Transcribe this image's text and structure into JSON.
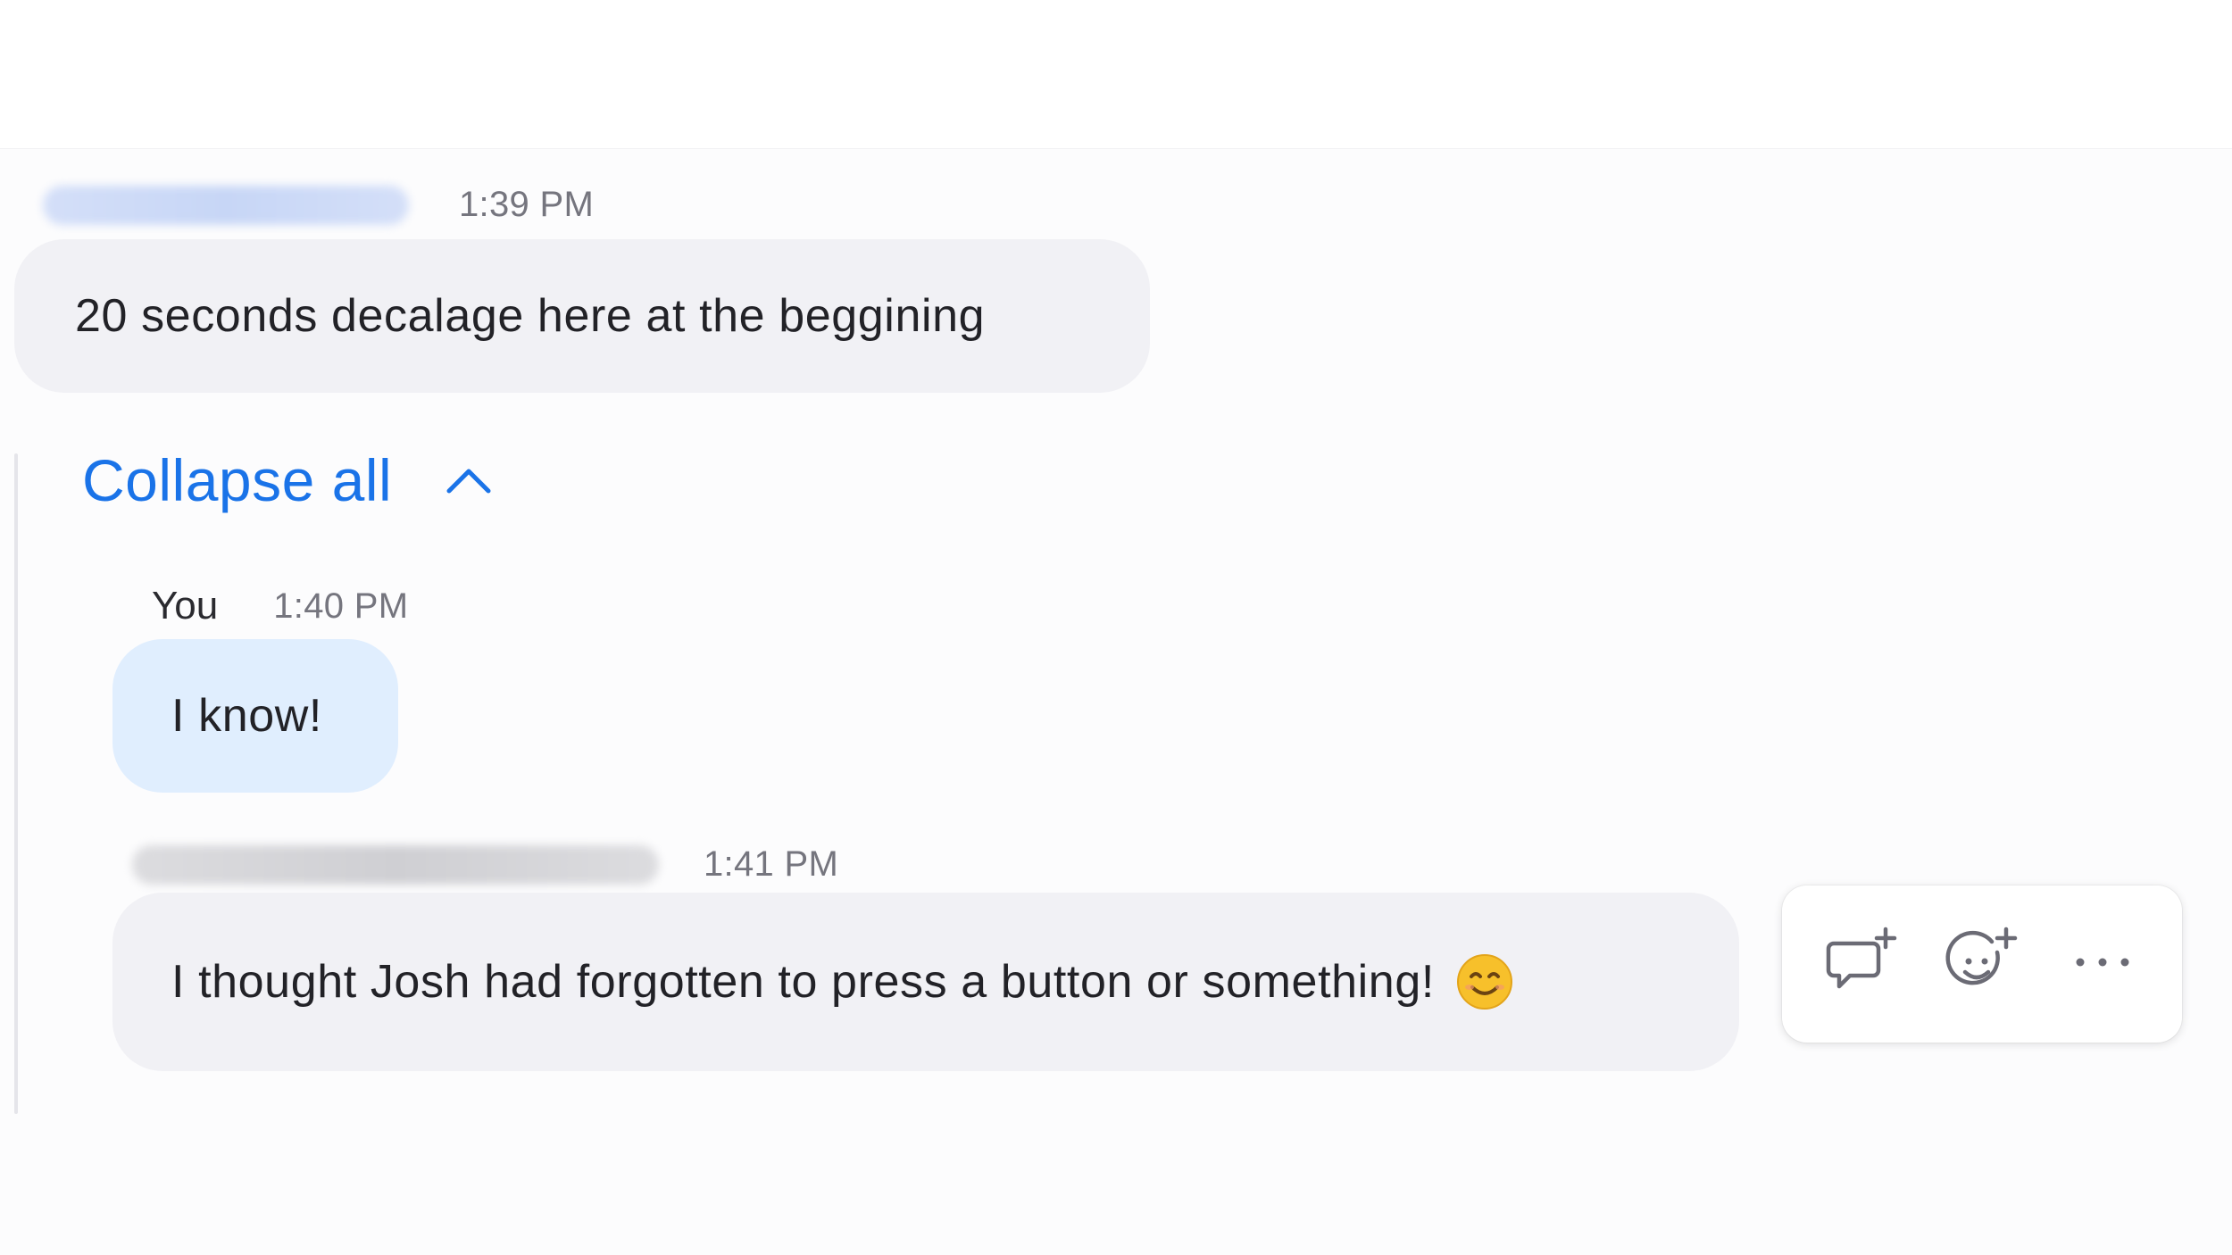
{
  "messages": [
    {
      "time": "1:39 PM",
      "text": "20 seconds decalage here at the beggining"
    }
  ],
  "thread": {
    "collapse_label": "Collapse all",
    "replies": [
      {
        "sender": "You",
        "time": "1:40 PM",
        "text": "I know!"
      },
      {
        "time": "1:41 PM",
        "text": "I thought Josh had forgotten to press a button or something!",
        "emoji": "smiling-face-emoji"
      }
    ]
  },
  "actions": [
    {
      "icon": "reply-in-thread-icon"
    },
    {
      "icon": "add-reaction-icon"
    },
    {
      "icon": "more-options-icon"
    }
  ],
  "colors": {
    "accent": "#1a73e8",
    "bubble_gray": "#f1f1f5",
    "bubble_self": "#e0eefe"
  }
}
